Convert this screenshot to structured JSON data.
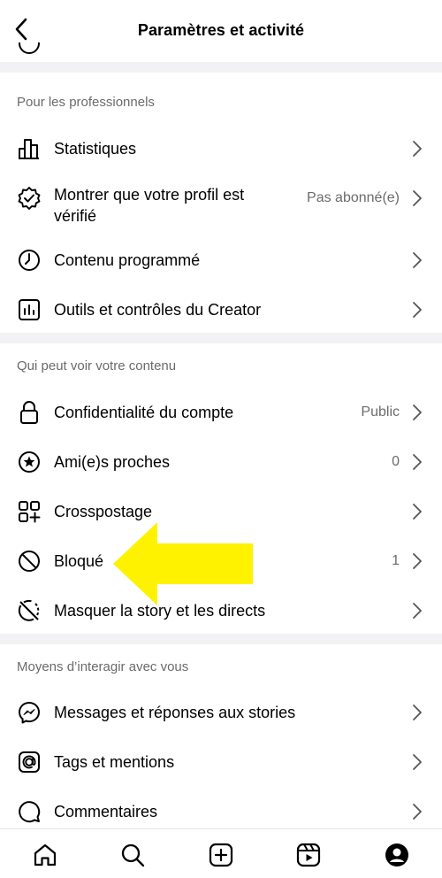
{
  "header": {
    "title": "Paramètres et activité"
  },
  "sections": [
    {
      "title": "Pour les professionnels",
      "items": [
        {
          "label": "Statistiques",
          "value": ""
        },
        {
          "label": "Montrer que votre profil est vérifié",
          "value": "Pas abonné(e)"
        },
        {
          "label": "Contenu programmé",
          "value": ""
        },
        {
          "label": "Outils et contrôles du Creator",
          "value": ""
        }
      ]
    },
    {
      "title": "Qui peut voir votre contenu",
      "items": [
        {
          "label": "Confidentialité du compte",
          "value": "Public"
        },
        {
          "label": "Ami(e)s proches",
          "value": "0"
        },
        {
          "label": "Crosspostage",
          "value": ""
        },
        {
          "label": "Bloqué",
          "value": "1"
        },
        {
          "label": "Masquer la story et les directs",
          "value": ""
        }
      ]
    },
    {
      "title": "Moyens d’interagir avec vous",
      "items": [
        {
          "label": "Messages et réponses aux stories",
          "value": ""
        },
        {
          "label": "Tags et mentions",
          "value": ""
        },
        {
          "label": "Commentaires",
          "value": ""
        }
      ]
    }
  ],
  "colors": {
    "highlight_arrow": "#fff200",
    "divider": "#f2f2f4",
    "secondary_text": "#6b6b6b"
  },
  "icons": [
    "back-arrow",
    "bar-chart",
    "verified-badge",
    "clock",
    "creator-tools",
    "lock",
    "star-circle",
    "crosspost",
    "blocked",
    "hide-story",
    "messenger",
    "at-sign",
    "comment",
    "home",
    "search",
    "create",
    "reels",
    "profile"
  ]
}
